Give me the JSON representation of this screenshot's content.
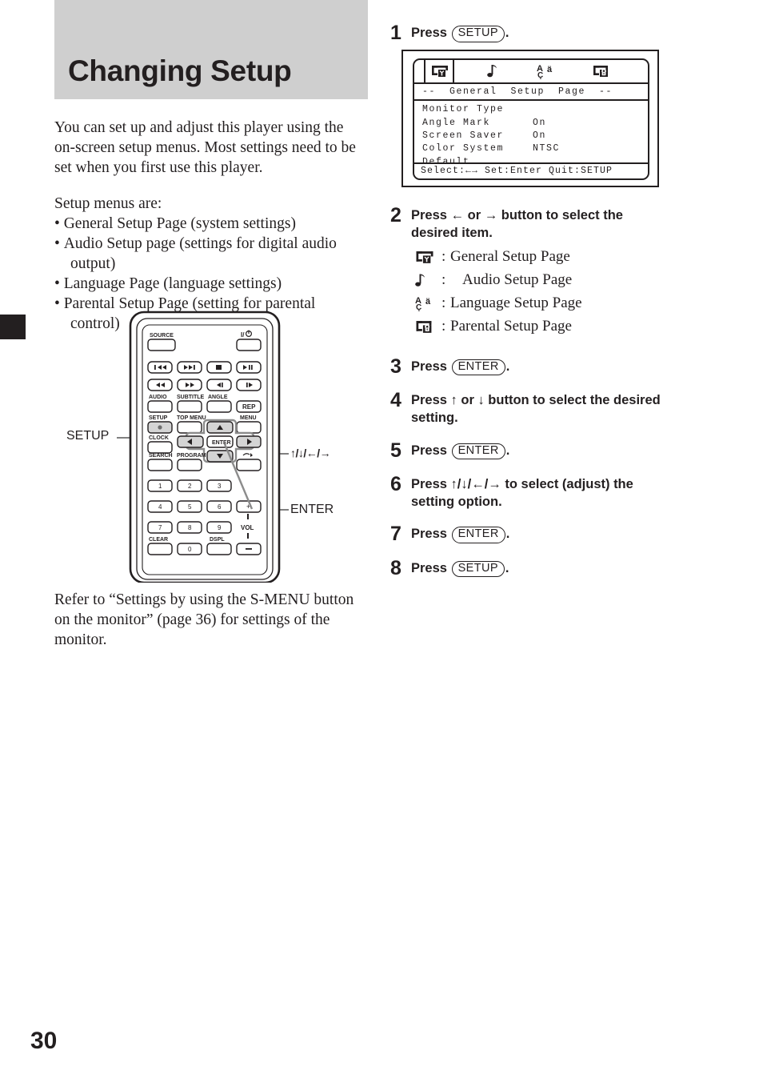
{
  "page": {
    "number": "30",
    "title": "Changing Setup"
  },
  "intro": {
    "paragraph": "You can set up and adjust this player using the on-screen setup menus. Most settings need to be set when you first use this player."
  },
  "menus": {
    "lead": "Setup menus are:",
    "items": [
      "General Setup Page (system settings)",
      "Audio Setup page (settings for digital audio output)",
      "Language Page (language settings)",
      "Parental Setup Page (setting for parental control)"
    ],
    "item_lines": [
      {
        "first": "General Setup Page (system settings)",
        "cont": ""
      },
      {
        "first": "Audio Setup page (settings for digital audio",
        "cont": "output)"
      },
      {
        "first": "Language Page (language settings)",
        "cont": ""
      },
      {
        "first": "Parental Setup Page (setting for parental",
        "cont": "control)"
      }
    ]
  },
  "remote": {
    "callouts": {
      "setup": "SETUP",
      "arrows": "↑/↓/←/→",
      "enter": "ENTER"
    },
    "buttons": {
      "source": "SOURCE",
      "power": "I/⏻",
      "prev": "⏮",
      "next": "⏭",
      "stop": "■",
      "play_pause": "▶❙❙",
      "rewind": "◀◀",
      "fast_forward": "▶▶",
      "slow_reverse": "◀❙",
      "slow_forward": "❙▶",
      "audio": "AUDIO",
      "subtitle": "SUBTITLE",
      "angle": "ANGLE",
      "rep": "REP",
      "setup": "SETUP",
      "top_menu": "TOP MENU",
      "menu": "MENU",
      "clock": "CLOCK",
      "search": "SEARCH",
      "program": "PROGRAM",
      "enter": "ENTER",
      "num1": "1",
      "num2": "2",
      "num3": "3",
      "num4": "4",
      "num5": "5",
      "num6": "6",
      "num7": "7",
      "num8": "8",
      "num9": "9",
      "num0": "0",
      "clear": "CLEAR",
      "dspl": "DSPL",
      "vol": "VOL",
      "vol_up": "+",
      "vol_down": "–"
    }
  },
  "refer": {
    "paragraph": "Refer to “Settings by using the S-MENU button on the monitor” (page 36) for settings of the monitor."
  },
  "steps": [
    {
      "num": "1",
      "pre": "Press",
      "key": "SETUP",
      "post": "."
    },
    {
      "num": "2",
      "line1": "Press ← or → button to select the",
      "line2": "desired item."
    },
    {
      "num": "3",
      "pre": "Press",
      "key": "ENTER",
      "post": "."
    },
    {
      "num": "4",
      "line1": "Press ↑ or ↓ button to select the desired",
      "line2": "setting."
    },
    {
      "num": "5",
      "pre": "Press",
      "key": "ENTER",
      "post": "."
    },
    {
      "num": "6",
      "line1": "Press ↑/↓/←/→ to select (adjust) the",
      "line2": "setting option."
    },
    {
      "num": "7",
      "pre": "Press",
      "key": "ENTER",
      "post": "."
    },
    {
      "num": "8",
      "pre": "Press",
      "key": "SETUP",
      "post": "."
    }
  ],
  "legend": [
    {
      "icon": "monitor-antenna-icon",
      "label": "General Setup Page"
    },
    {
      "icon": "music-note-icon",
      "label": "Audio Setup Page"
    },
    {
      "icon": "language-letters-icon",
      "label": "Language Setup Page"
    },
    {
      "icon": "monitor-lock-icon",
      "label": "Parental Setup Page"
    }
  ],
  "osd": {
    "title": "--  General  Setup  Page  --",
    "rows": [
      {
        "label": "Monitor Type",
        "value": ""
      },
      {
        "label": "Angle Mark",
        "value": "On"
      },
      {
        "label": "Screen Saver",
        "value": "On"
      },
      {
        "label": "Color System",
        "value": "NTSC"
      },
      {
        "label": "Default",
        "value": ""
      }
    ],
    "footer": "Select:←→ Set:Enter Quit:SETUP",
    "tabs": [
      "monitor-antenna-icon",
      "music-note-icon",
      "language-letters-icon",
      "monitor-lock-icon"
    ]
  },
  "colors": {
    "title_band": "#cfcfcf",
    "ink": "#231f20",
    "leader": "#808080",
    "key_fill": "#d4d4d4"
  }
}
